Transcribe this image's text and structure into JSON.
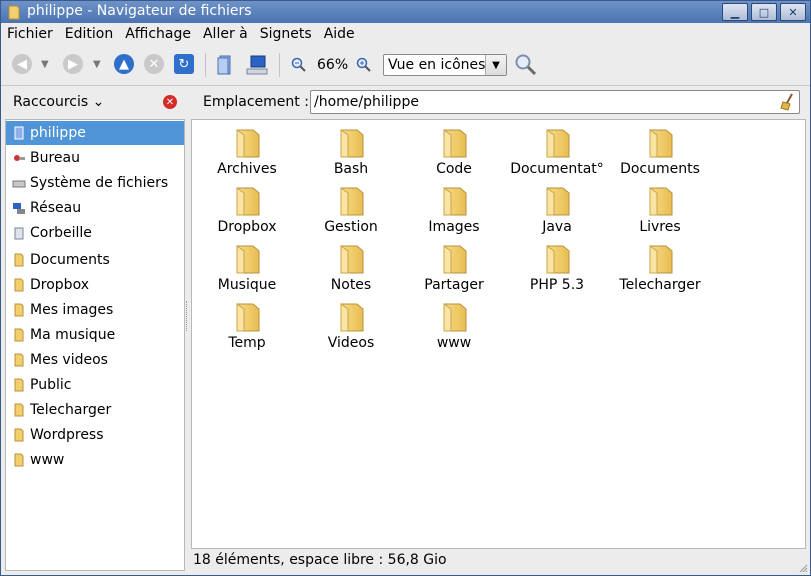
{
  "window": {
    "title": "philippe - Navigateur de fichiers"
  },
  "menubar": [
    "Fichier",
    "Edition",
    "Affichage",
    "Aller à",
    "Signets",
    "Aide"
  ],
  "toolbar": {
    "zoom_level": "66%",
    "view_mode": "Vue en icônes",
    "icons": [
      "back-icon",
      "forward-icon",
      "up-icon",
      "stop-icon",
      "reload-icon",
      "bookmarks-icon",
      "computer-icon",
      "zoom-out-icon",
      "zoom-in-icon",
      "search-icon"
    ]
  },
  "sidebar": {
    "header": "Raccourcis",
    "items": [
      {
        "label": "philippe",
        "icon": "home-icon",
        "selected": true
      },
      {
        "label": "Bureau",
        "icon": "desktop-icon"
      },
      {
        "label": "Système de fichiers",
        "icon": "drive-icon"
      },
      {
        "label": "Réseau",
        "icon": "network-icon"
      },
      {
        "label": "Corbeille",
        "icon": "trash-icon"
      },
      {
        "label": "Documents",
        "icon": "folder-icon"
      },
      {
        "label": "Dropbox",
        "icon": "folder-icon"
      },
      {
        "label": "Mes images",
        "icon": "folder-icon"
      },
      {
        "label": "Ma musique",
        "icon": "folder-icon"
      },
      {
        "label": "Mes videos",
        "icon": "folder-icon"
      },
      {
        "label": "Public",
        "icon": "folder-icon"
      },
      {
        "label": "Telecharger",
        "icon": "folder-icon"
      },
      {
        "label": "Wordpress",
        "icon": "folder-icon"
      },
      {
        "label": "www",
        "icon": "folder-icon"
      }
    ]
  },
  "location": {
    "label": "Emplacement :",
    "path": "/home/philippe"
  },
  "files": [
    "Archives",
    "Bash",
    "Code",
    "Documentat°",
    "Documents",
    "Dropbox",
    "Gestion",
    "Images",
    "Java",
    "Livres",
    "Musique",
    "Notes",
    "Partager",
    "PHP 5.3",
    "Telecharger",
    "Temp",
    "Videos",
    "www"
  ],
  "status": {
    "text": "18 éléments, espace libre : 56,8 Gio"
  },
  "colors": {
    "selection": "#4f95d8",
    "titlebar": "#5a80bd",
    "folder": "#f2cf6c"
  }
}
